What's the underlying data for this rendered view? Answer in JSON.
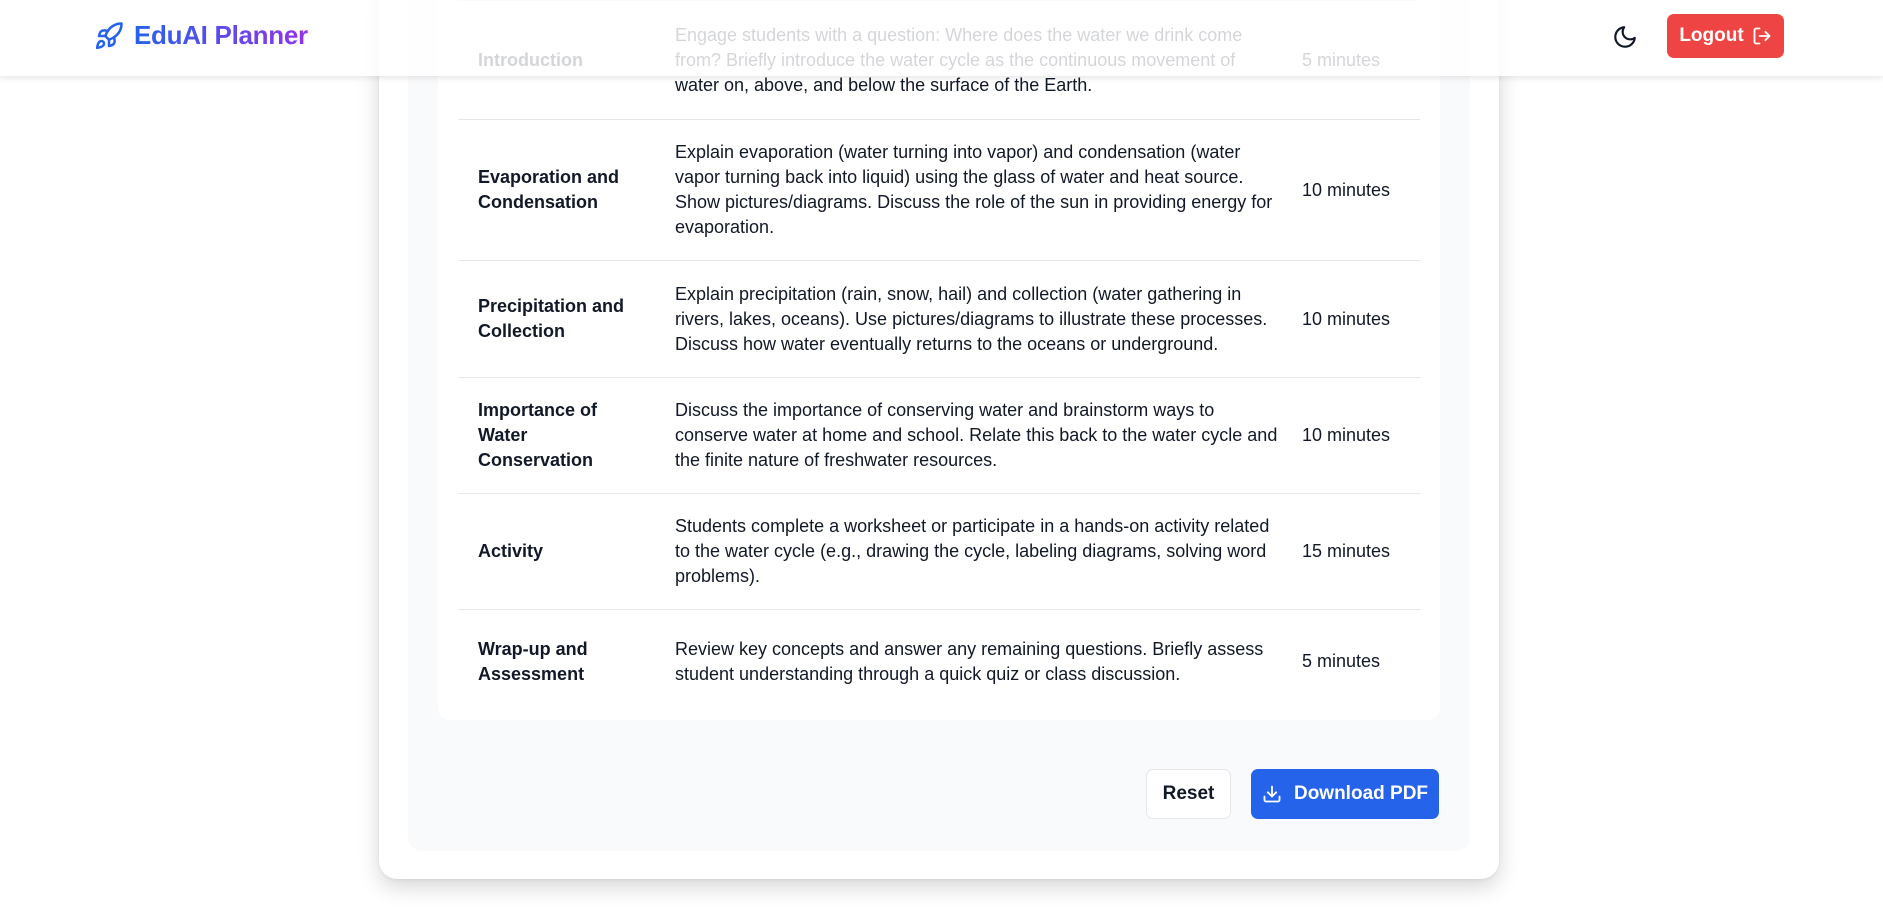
{
  "header": {
    "brand_name": "EduAI Planner",
    "brand_icon": "rocket-icon",
    "theme_icon": "moon-icon",
    "logout_label": "Logout",
    "logout_icon": "log-out-icon"
  },
  "colors": {
    "brand_gradient_start": "#2563eb",
    "brand_gradient_end": "#9333ea",
    "logout": "#ef4444",
    "primary": "#2563eb"
  },
  "lesson_plan": {
    "rows": [
      {
        "step": "Introduction",
        "description": "Engage students with a question: Where does the water we drink come from? Briefly introduce the water cycle as the continuous movement of water on, above, and below the surface of the Earth.",
        "duration": "5 minutes"
      },
      {
        "step": "Evaporation and Condensation",
        "description": "Explain evaporation (water turning into vapor) and condensation (water vapor turning back into liquid) using the glass of water and heat source. Show pictures/diagrams. Discuss the role of the sun in providing energy for evaporation.",
        "duration": "10 minutes"
      },
      {
        "step": "Precipitation and Collection",
        "description": "Explain precipitation (rain, snow, hail) and collection (water gathering in rivers, lakes, oceans). Use pictures/diagrams to illustrate these processes. Discuss how water eventually returns to the oceans or underground.",
        "duration": "10 minutes"
      },
      {
        "step": "Importance of Water Conservation",
        "description": "Discuss the importance of conserving water and brainstorm ways to conserve water at home and school. Relate this back to the water cycle and the finite nature of freshwater resources.",
        "duration": "10 minutes"
      },
      {
        "step": "Activity",
        "description": "Students complete a worksheet or participate in a hands-on activity related to the water cycle (e.g., drawing the cycle, labeling diagrams, solving word problems).",
        "duration": "15 minutes"
      },
      {
        "step": "Wrap-up and Assessment",
        "description": "Review key concepts and answer any remaining questions. Briefly assess student understanding through a quick quiz or class discussion.",
        "duration": "5 minutes"
      }
    ]
  },
  "actions": {
    "reset_label": "Reset",
    "download_label": "Download PDF",
    "download_icon": "download-icon"
  }
}
